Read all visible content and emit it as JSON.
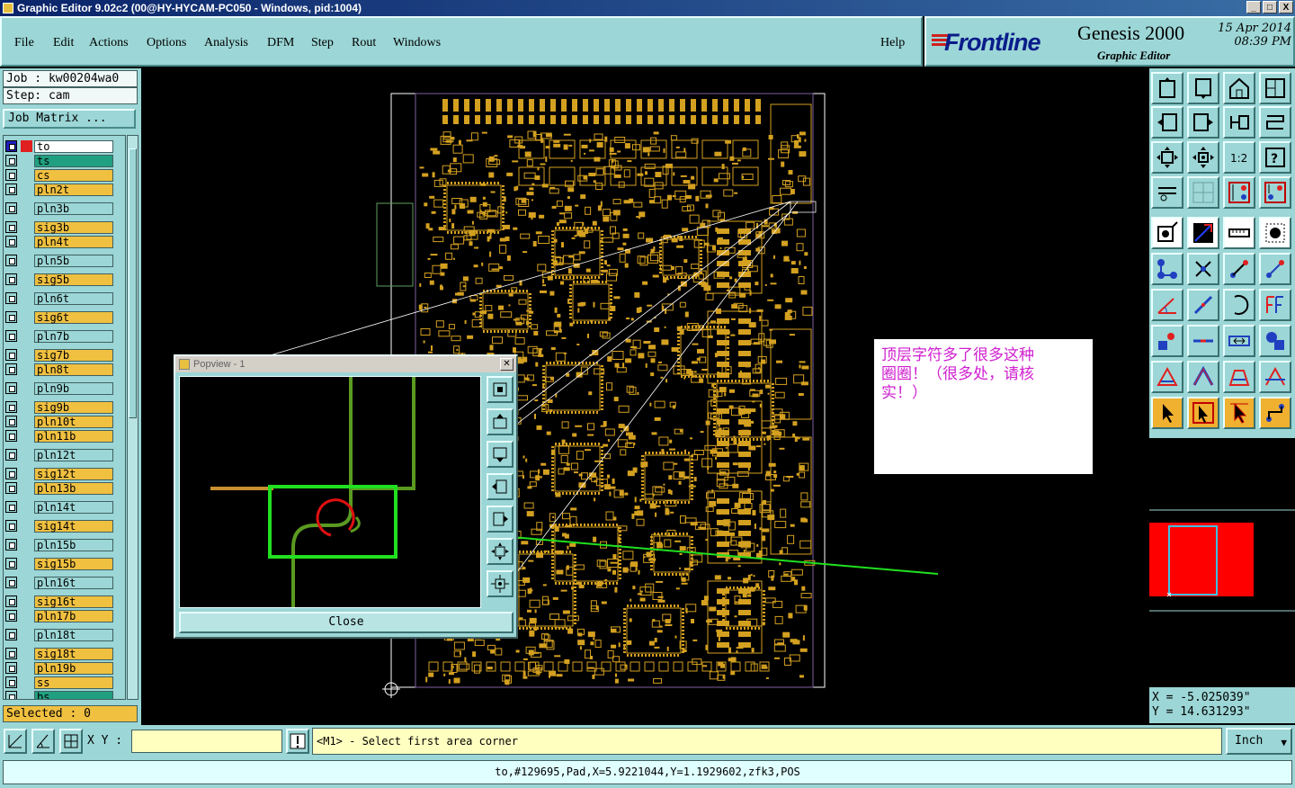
{
  "window": {
    "title": "Graphic Editor 9.02c2 (00@HY-HYCAM-PC050 - Windows, pid:1004)",
    "buttons": [
      "_",
      "□",
      "X"
    ]
  },
  "menu": {
    "items": [
      "File",
      "Edit",
      "Actions",
      "Options",
      "Analysis",
      "DFM",
      "Step",
      "Rout",
      "Windows"
    ],
    "help": "Help"
  },
  "brand": {
    "logo": "Frontline",
    "product": "Genesis 2000",
    "subtitle": "Graphic Editor",
    "date": "15 Apr 2014",
    "time": "08:39 PM"
  },
  "job": {
    "job_line": "Job : kw00204wa0",
    "step_line": "Step: cam",
    "matrix_button": "Job Matrix ..."
  },
  "layers": [
    {
      "name": "to",
      "type": "white",
      "color": "#e02020"
    },
    {
      "name": "ts",
      "type": "green"
    },
    {
      "name": "cs",
      "type": "signal"
    },
    {
      "name": "pln2t",
      "type": "signal"
    },
    {
      "name": "pln3b",
      "type": "power"
    },
    {
      "name": "sig3b",
      "type": "signal"
    },
    {
      "name": "pln4t",
      "type": "signal"
    },
    {
      "name": "pln5b",
      "type": "power"
    },
    {
      "name": "sig5b",
      "type": "signal"
    },
    {
      "name": "pln6t",
      "type": "power"
    },
    {
      "name": "sig6t",
      "type": "signal"
    },
    {
      "name": "pln7b",
      "type": "power"
    },
    {
      "name": "sig7b",
      "type": "signal"
    },
    {
      "name": "pln8t",
      "type": "signal"
    },
    {
      "name": "pln9b",
      "type": "power"
    },
    {
      "name": "sig9b",
      "type": "signal"
    },
    {
      "name": "pln10t",
      "type": "signal"
    },
    {
      "name": "pln11b",
      "type": "signal"
    },
    {
      "name": "pln12t",
      "type": "power"
    },
    {
      "name": "sig12t",
      "type": "signal"
    },
    {
      "name": "pln13b",
      "type": "signal"
    },
    {
      "name": "pln14t",
      "type": "power"
    },
    {
      "name": "sig14t",
      "type": "signal"
    },
    {
      "name": "pln15b",
      "type": "power"
    },
    {
      "name": "sig15b",
      "type": "signal"
    },
    {
      "name": "pln16t",
      "type": "power"
    },
    {
      "name": "sig16t",
      "type": "signal"
    },
    {
      "name": "pln17b",
      "type": "signal"
    },
    {
      "name": "pln18t",
      "type": "power"
    },
    {
      "name": "sig18t",
      "type": "signal"
    },
    {
      "name": "pln19b",
      "type": "signal"
    },
    {
      "name": "ss",
      "type": "signal"
    },
    {
      "name": "bs",
      "type": "green"
    }
  ],
  "selected": "Selected : 0",
  "popview": {
    "title": "Popview - 1",
    "close_label": "Close"
  },
  "note": {
    "line1": "顶层字符多了很多这种",
    "line2": "圈圈！（很多处，请核",
    "line3": "实！）"
  },
  "coords": {
    "x": "X  = -5.025039\"",
    "y": "Y  = 14.631293\""
  },
  "command": {
    "xy_label": "X Y :",
    "xy_value": "",
    "prompt": "<M1> - Select first area corner",
    "unit": "Inch"
  },
  "status": "to,#129695,Pad,X=5.9221044,Y=1.1929602,zfk3,POS",
  "colors": {
    "panel": "#9cd6d6",
    "copper": "#d4a020",
    "highlight": "#20e020",
    "pad": "#e01010",
    "note_text": "#d020d0"
  }
}
